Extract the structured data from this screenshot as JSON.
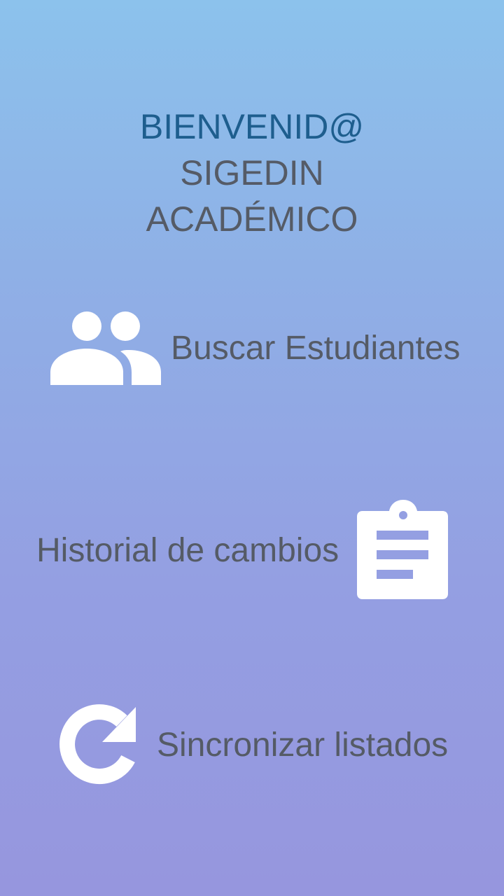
{
  "header": {
    "welcome": "BIENVENID@",
    "app_name": "SIGEDIN",
    "app_subtitle": "ACADÉMICO"
  },
  "menu": {
    "search_students": {
      "label": "Buscar Estudiantes",
      "icon": "people-icon"
    },
    "change_history": {
      "label": "Historial de cambios",
      "icon": "clipboard-icon"
    },
    "sync_lists": {
      "label": "Sincronizar listados",
      "icon": "refresh-icon"
    }
  },
  "colors": {
    "background_top": "#8cc2ec",
    "background_bottom": "#9696de",
    "welcome_text": "#1e5e8e",
    "body_text": "#555b66",
    "icon": "#ffffff"
  }
}
